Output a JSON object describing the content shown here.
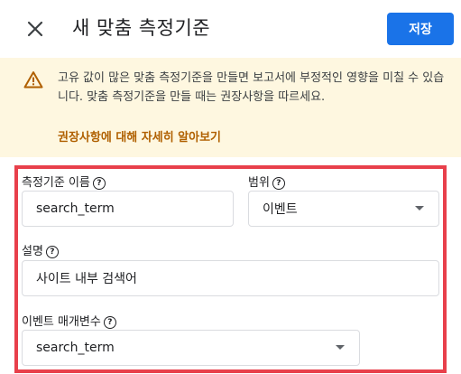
{
  "header": {
    "title": "새 맞춤 측정기준",
    "save_label": "저장",
    "close_icon": "close-icon"
  },
  "banner": {
    "text": "고유 값이 많은 맞춤 측정기준을 만들면 보고서에 부정적인 영향을 미칠 수 있습니다. 맞춤 측정기준을 만들 때는 권장사항을 따르세요.",
    "link": "권장사항에 대해 자세히 알아보기",
    "icon": "warning-icon"
  },
  "form": {
    "name_label": "측정기준 이름",
    "name_value": "search_term",
    "scope_label": "범위",
    "scope_value": "이벤트",
    "description_label": "설명",
    "description_value": "사이트 내부 검색어",
    "param_label": "이벤트 매개변수",
    "param_value": "search_term",
    "help_glyph": "?"
  },
  "colors": {
    "accent": "#1a73e8",
    "banner_bg": "#fef7e0",
    "link": "#b06000",
    "highlight_border": "#e8404b"
  }
}
